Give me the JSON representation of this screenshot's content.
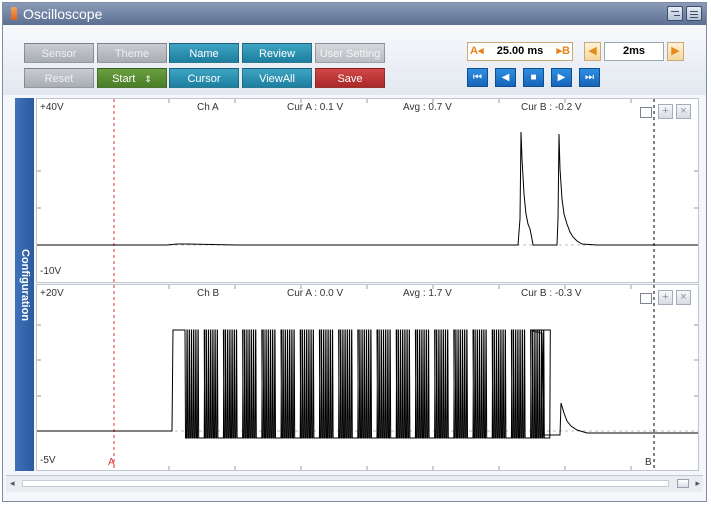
{
  "window": {
    "title": "Oscilloscope"
  },
  "toolbar": {
    "sensor": "Sensor",
    "theme": "Theme",
    "name": "Name",
    "review": "Review",
    "user_setting": "User Setting",
    "reset": "Reset",
    "start": "Start",
    "start_arrows": "⇕",
    "cursor": "Cursor",
    "view_all": "ViewAll",
    "save": "Save"
  },
  "cursor_control": {
    "a_label": "A◂",
    "value": "25.00 ms",
    "b_label": "▸B"
  },
  "time_div": {
    "value": "2ms",
    "left_arrow": "◀",
    "right_arrow": "▶"
  },
  "nav": {
    "first": "⏮",
    "prev": "◀",
    "stop": "■",
    "next": "▶",
    "last": "⏭"
  },
  "side_tab": {
    "label": "Configuration"
  },
  "channel_a": {
    "top_label": "+40V",
    "bottom_label": "-10V",
    "name": "Ch A",
    "cur_a": "Cur A : 0.1 V",
    "avg": "Avg : 0.7 V",
    "cur_b": "Cur B : -0.2 V"
  },
  "channel_b": {
    "top_label": "+20V",
    "bottom_label": "-5V",
    "name": "Ch B",
    "cur_a": "Cur A : 0.0 V",
    "avg": "Avg : 1.7 V",
    "cur_b": "Cur B : -0.3 V",
    "cursor_a_marker": "A",
    "cursor_b_marker": "B"
  },
  "panel_buttons": {
    "add": "+",
    "close": "×"
  },
  "colors": {
    "trace": "#000000",
    "cursor_a": "#e03030",
    "cursor_b": "#000000",
    "grid": "#bfbfbf"
  }
}
